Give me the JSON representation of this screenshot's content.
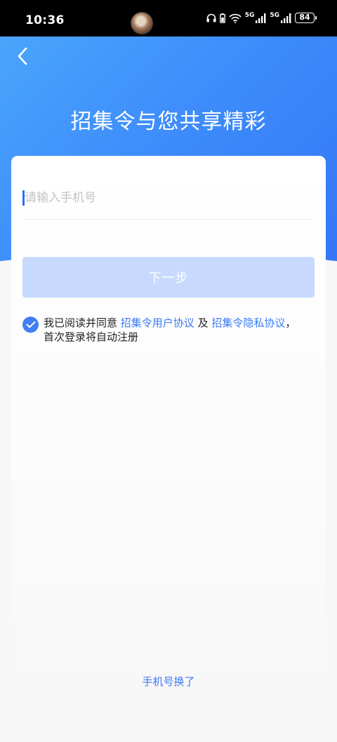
{
  "status_bar": {
    "time": "10:36",
    "signal_1_label": "5G",
    "signal_2_label": "5G",
    "battery_level": "84",
    "icons": [
      "headphones-icon",
      "battery-saver-icon",
      "wifi-icon",
      "signal-icon",
      "signal-icon",
      "battery-icon"
    ]
  },
  "header": {
    "back_icon": "chevron-left-icon",
    "title": "招集令与您共享精彩"
  },
  "login_form": {
    "phone_placeholder": "请输入手机号",
    "phone_value": "",
    "next_label": "下一步"
  },
  "agreement": {
    "checked": true,
    "prefix": "我已阅读并同意",
    "user_agreement_link": "招集令用户协议",
    "conjunction": "及",
    "privacy_link": "招集令隐私协议",
    "punctuation": "，",
    "suffix": "首次登录将自动注册"
  },
  "footer": {
    "change_phone_label": "手机号换了"
  },
  "colors": {
    "brand_blue": "#3d8bfb",
    "link_blue": "#3b7bf4",
    "button_disabled": "#c7d9fc",
    "checkbox_blue": "#3e7ff5"
  }
}
